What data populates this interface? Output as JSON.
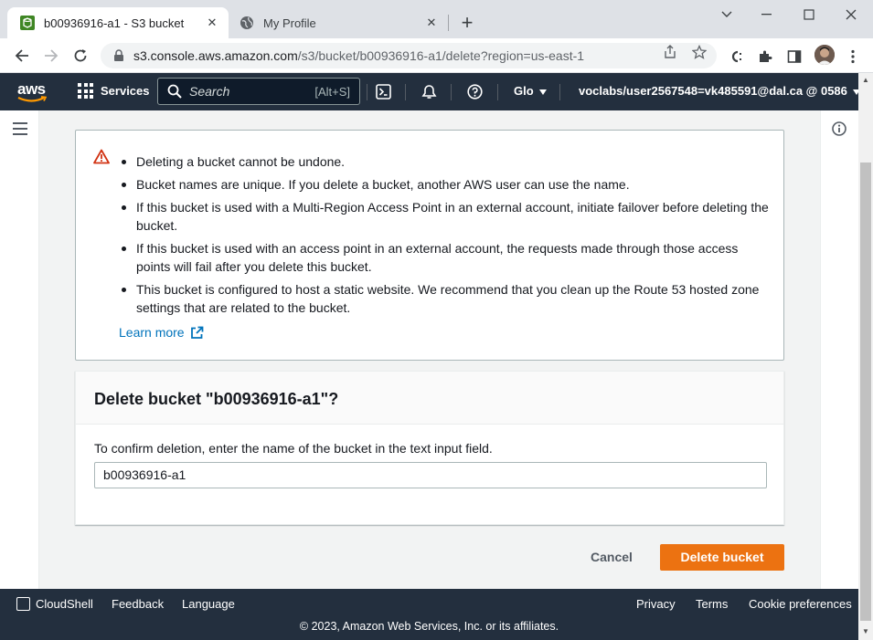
{
  "browser": {
    "tabs": [
      {
        "title": "b00936916-a1 - S3 bucket",
        "active": true
      },
      {
        "title": "My Profile",
        "active": false
      }
    ],
    "url_host": "s3.console.aws.amazon.com",
    "url_path": "/s3/bucket/b00936916-a1/delete?region=us-east-1"
  },
  "aws_header": {
    "logo": "aws",
    "services_label": "Services",
    "search_placeholder": "Search",
    "search_shortcut": "[Alt+S]",
    "region_label": "Glo",
    "account_label": "voclabs/user2567548=vk485591@dal.ca @ 0586"
  },
  "alert": {
    "items": [
      "Deleting a bucket cannot be undone.",
      "Bucket names are unique. If you delete a bucket, another AWS user can use the name.",
      "If this bucket is used with a Multi-Region Access Point in an external account, initiate failover before deleting the bucket.",
      "If this bucket is used with an access point in an external account, the requests made through those access points will fail after you delete this bucket.",
      "This bucket is configured to host a static website. We recommend that you clean up the Route 53 hosted zone settings that are related to the bucket."
    ],
    "learn_more": "Learn more"
  },
  "delete_panel": {
    "title": "Delete bucket \"b00936916-a1\"?",
    "confirm_label": "To confirm deletion, enter the name of the bucket in the text input field.",
    "input_value": "b00936916-a1"
  },
  "actions": {
    "cancel": "Cancel",
    "delete": "Delete bucket"
  },
  "footer": {
    "cloudshell": "CloudShell",
    "feedback": "Feedback",
    "language": "Language",
    "privacy": "Privacy",
    "terms": "Terms",
    "cookie": "Cookie preferences",
    "copyright": "© 2023, Amazon Web Services, Inc. or its affiliates."
  },
  "colors": {
    "aws_nav": "#232f3e",
    "primary_button": "#ec7211",
    "link": "#0073bb",
    "warning": "#d13212"
  }
}
